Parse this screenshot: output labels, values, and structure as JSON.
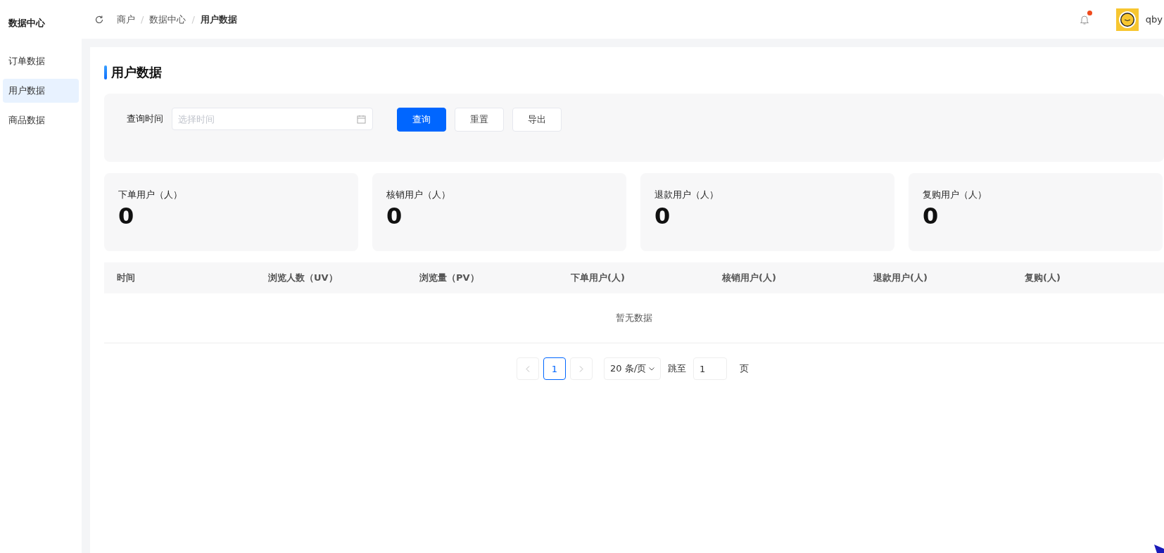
{
  "sidebar": {
    "title": "数据中心",
    "items": [
      {
        "label": "订单数据",
        "selected": false
      },
      {
        "label": "用户数据",
        "selected": true
      },
      {
        "label": "商品数据",
        "selected": false
      }
    ]
  },
  "header": {
    "breadcrumb": [
      {
        "kind": "link",
        "label": "商户"
      },
      {
        "kind": "separator",
        "label": "/"
      },
      {
        "kind": "link",
        "label": "数据中心"
      },
      {
        "kind": "separator",
        "label": "/"
      },
      {
        "kind": "current",
        "label": "用户数据"
      }
    ],
    "notification": {
      "unread": true
    },
    "user": {
      "name": "qby"
    }
  },
  "page": {
    "title": "用户数据"
  },
  "filter": {
    "label": "查询时间",
    "placeholder": "选择时间",
    "buttons": [
      {
        "label": "查询",
        "kind": "primary"
      },
      {
        "label": "重置",
        "kind": "default"
      },
      {
        "label": "导出",
        "kind": "default"
      }
    ]
  },
  "stats": [
    {
      "label": "下单用户（人）",
      "value": "0"
    },
    {
      "label": "核销用户（人）",
      "value": "0"
    },
    {
      "label": "退款用户（人）",
      "value": "0"
    },
    {
      "label": "复购用户（人）",
      "value": "0"
    }
  ],
  "table": {
    "columns": [
      "时间",
      "浏览人数（UV）",
      "浏览量（PV）",
      "下单用户(人)",
      "核销用户(人)",
      "退款用户(人)",
      "复购(人)"
    ],
    "empty_text": "暂无数据"
  },
  "pagination": {
    "pages": [
      {
        "label": "1",
        "selected": true
      }
    ],
    "page_size": "20 条/页",
    "jump_label": "跳至",
    "jump_value": "1",
    "page_unit": "页"
  }
}
